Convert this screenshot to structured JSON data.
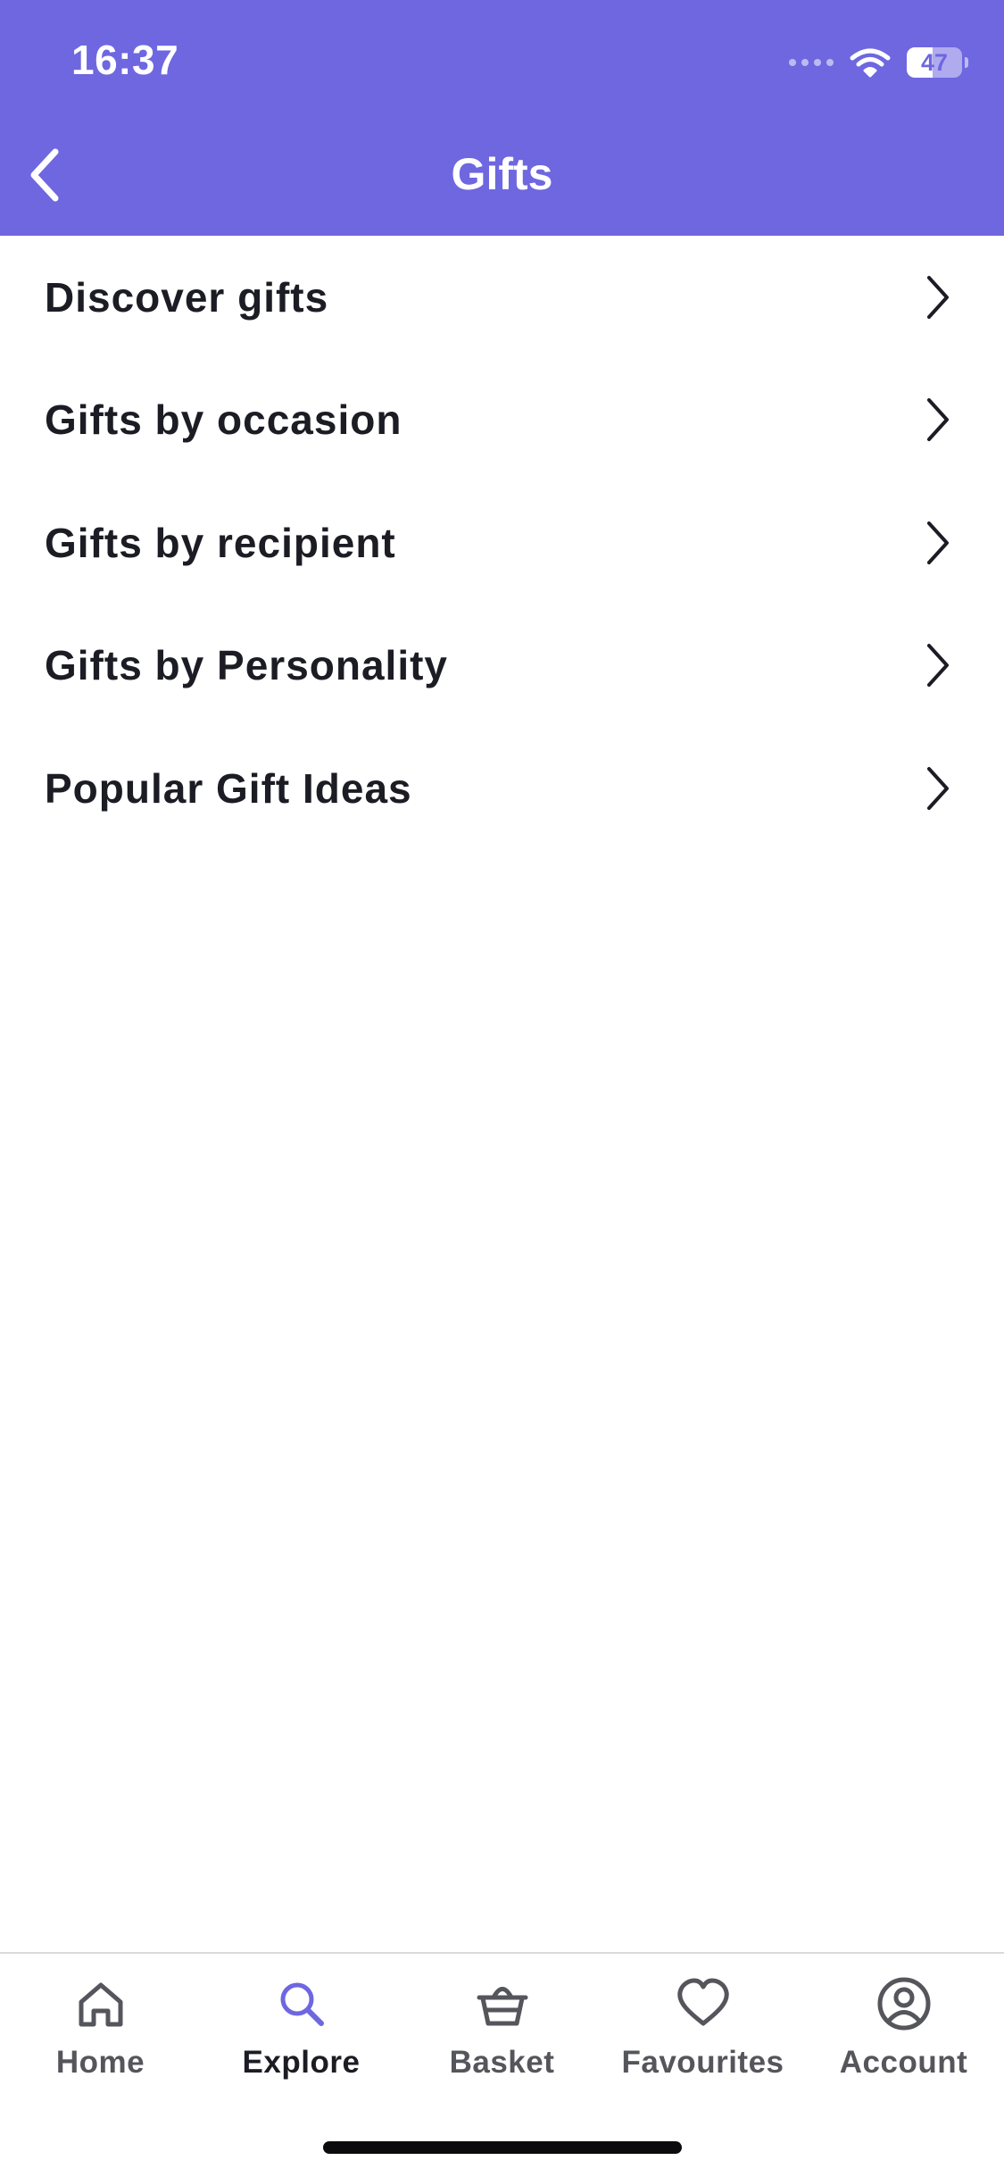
{
  "status_bar": {
    "time": "16:37",
    "battery": "47",
    "battery_fraction": 0.47
  },
  "header": {
    "title": "Gifts",
    "background": "#6e67e0",
    "back_icon": "chevron-left-icon"
  },
  "menu": {
    "items": [
      {
        "label": "Discover gifts",
        "icon": "chevron-right-icon"
      },
      {
        "label": "Gifts by occasion",
        "icon": "chevron-right-icon"
      },
      {
        "label": "Gifts by recipient",
        "icon": "chevron-right-icon"
      },
      {
        "label": "Gifts by Personality",
        "icon": "chevron-right-icon"
      },
      {
        "label": "Popular Gift Ideas",
        "icon": "chevron-right-icon"
      }
    ]
  },
  "tab_bar": {
    "active": "Explore",
    "accent": "#6e67e0",
    "tabs": [
      {
        "label": "Home",
        "icon": "home-icon"
      },
      {
        "label": "Explore",
        "icon": "search-icon"
      },
      {
        "label": "Basket",
        "icon": "basket-icon"
      },
      {
        "label": "Favourites",
        "icon": "heart-icon"
      },
      {
        "label": "Account",
        "icon": "account-icon"
      }
    ]
  }
}
